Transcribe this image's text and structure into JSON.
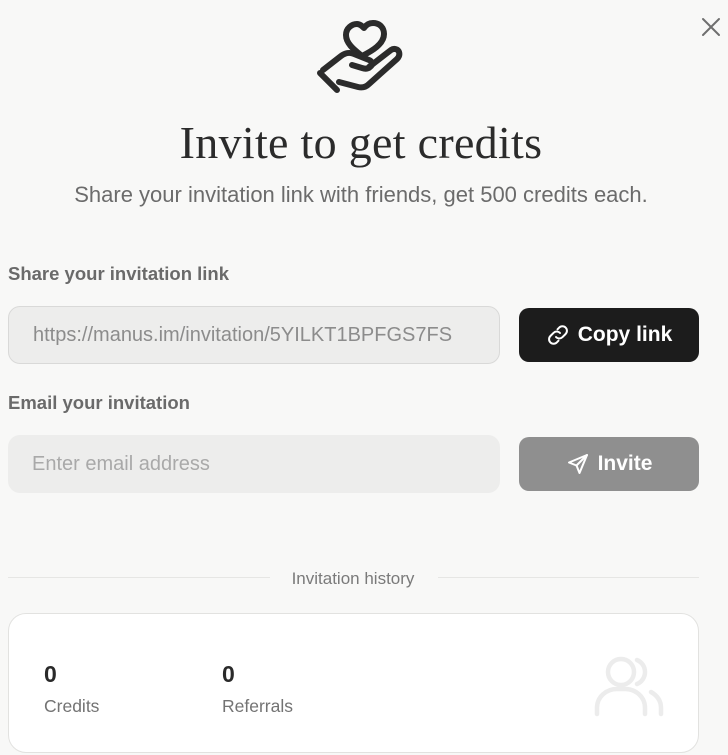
{
  "header": {
    "title": "Invite to get credits",
    "subtitle": "Share your invitation link with friends, get 500 credits each."
  },
  "share": {
    "label": "Share your invitation link",
    "link": "https://manus.im/invitation/5YILKT1BPFGS7FS",
    "copy_label": "Copy link"
  },
  "email": {
    "label": "Email your invitation",
    "placeholder": "Enter email address",
    "value": "",
    "invite_label": "Invite"
  },
  "history": {
    "label": "Invitation history",
    "credits_value": "0",
    "credits_label": "Credits",
    "referrals_value": "0",
    "referrals_label": "Referrals"
  },
  "icons": {
    "close": "close-icon",
    "hero": "heart-hand-icon",
    "copy": "link-icon",
    "invite": "send-icon",
    "history": "users-icon"
  },
  "colors": {
    "background": "#f8f8f7",
    "primary_button": "#1c1c1c",
    "disabled_button": "#8f8f8f",
    "field_background": "#ededec"
  }
}
